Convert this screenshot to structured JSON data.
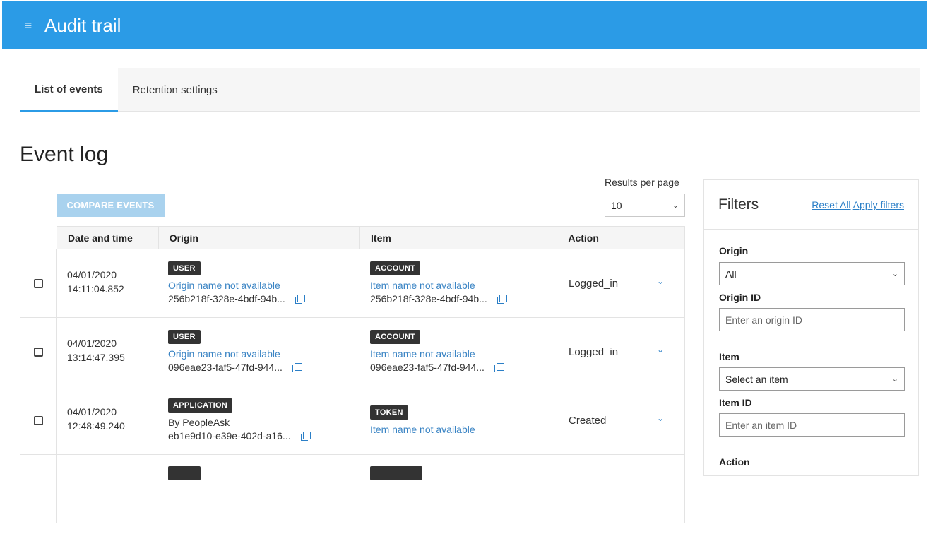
{
  "header": {
    "menu_icon": "hamburger-menu-icon",
    "title": "Audit trail",
    "color": "#2b9be6"
  },
  "tabs": [
    {
      "label": "List of events",
      "active": true
    },
    {
      "label": "Retention settings",
      "active": false
    }
  ],
  "page_title": "Event log",
  "toolbar": {
    "compare_label": "COMPARE EVENTS",
    "results_per_page_label": "Results per page",
    "results_per_page_value": "10"
  },
  "table": {
    "headers": [
      "Date and time",
      "Origin",
      "Item",
      "Action"
    ],
    "rows": [
      {
        "date": "04/01/2020",
        "time": "14:11:04.852",
        "origin_type": "USER",
        "origin_name": "Origin name not available",
        "origin_id": "256b218f-328e-4bdf-94b...",
        "item_type": "ACCOUNT",
        "item_name": "Item name not available",
        "item_id": "256b218f-328e-4bdf-94b...",
        "action": "Logged_in"
      },
      {
        "date": "04/01/2020",
        "time": "13:14:47.395",
        "origin_type": "USER",
        "origin_name": "Origin name not available",
        "origin_id": "096eae23-faf5-47fd-944...",
        "item_type": "ACCOUNT",
        "item_name": "Item name not available",
        "item_id": "096eae23-faf5-47fd-944...",
        "action": "Logged_in"
      },
      {
        "date": "04/01/2020",
        "time": "12:48:49.240",
        "origin_type": "APPLICATION",
        "origin_name": "By PeopleAsk",
        "origin_id": "eb1e9d10-e39e-402d-a16...",
        "item_type": "TOKEN",
        "item_name": "Item name not available",
        "item_id": "",
        "action": "Created"
      }
    ]
  },
  "filters": {
    "title": "Filters",
    "reset_label": "Reset All",
    "apply_label": "Apply filters",
    "origin_label": "Origin",
    "origin_value": "All",
    "origin_id_label": "Origin ID",
    "origin_id_placeholder": "Enter an origin ID",
    "item_label": "Item",
    "item_value": "Select an item",
    "item_id_label": "Item ID",
    "item_id_placeholder": "Enter an item ID",
    "action_label": "Action"
  }
}
